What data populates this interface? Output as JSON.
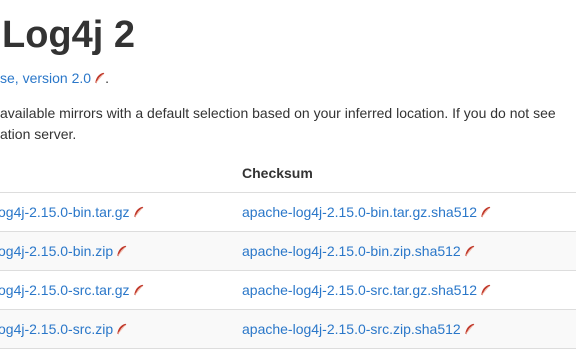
{
  "page": {
    "title": "Log4j 2",
    "license_link": "se, version 2.0",
    "license_suffix": ".",
    "intro_line1": "available mirrors with a default selection based on your inferred location. If you do not see",
    "intro_line2": "ation server."
  },
  "table": {
    "headers": [
      "",
      "Checksum"
    ],
    "rows": [
      {
        "file": "og4j-2.15.0-bin.tar.gz",
        "checksum": "apache-log4j-2.15.0-bin.tar.gz.sha512"
      },
      {
        "file": "og4j-2.15.0-bin.zip",
        "checksum": "apache-log4j-2.15.0-bin.zip.sha512"
      },
      {
        "file": "og4j-2.15.0-src.tar.gz",
        "checksum": "apache-log4j-2.15.0-src.tar.gz.sha512"
      },
      {
        "file": "og4j-2.15.0-src.zip",
        "checksum": "apache-log4j-2.15.0-src.zip.sha512"
      }
    ]
  },
  "icons": {
    "external_link": "apache-feather-icon"
  },
  "colors": {
    "link": "#2a77c9",
    "text": "#333333",
    "feather": "#c0392b",
    "row_alt": "#f9f9f9",
    "border": "#dddddd"
  }
}
